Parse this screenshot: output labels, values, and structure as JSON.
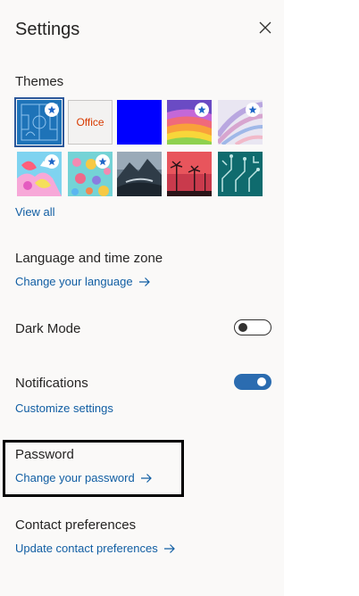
{
  "panel": {
    "title": "Settings",
    "close_icon": "close-icon"
  },
  "themes": {
    "heading": "Themes",
    "view_all": "View all",
    "tiles": [
      {
        "name": "theme-blueprint",
        "selected": true,
        "premium": true
      },
      {
        "name": "theme-office",
        "label": "Office",
        "selected": false,
        "premium": false
      },
      {
        "name": "theme-blue",
        "selected": false,
        "premium": false
      },
      {
        "name": "theme-rainbow",
        "selected": false,
        "premium": true
      },
      {
        "name": "theme-abstract",
        "selected": false,
        "premium": true
      },
      {
        "name": "theme-unicorn",
        "selected": false,
        "premium": true
      },
      {
        "name": "theme-cupcakes",
        "selected": false,
        "premium": true
      },
      {
        "name": "theme-mountain",
        "selected": false,
        "premium": false
      },
      {
        "name": "theme-palm-sunset",
        "selected": false,
        "premium": false
      },
      {
        "name": "theme-circuit",
        "selected": false,
        "premium": false
      }
    ]
  },
  "language": {
    "heading": "Language and time zone",
    "link": "Change your language"
  },
  "dark_mode": {
    "label": "Dark Mode",
    "enabled": false
  },
  "notifications": {
    "heading": "Notifications",
    "enabled": true,
    "link": "Customize settings"
  },
  "password": {
    "heading": "Password",
    "link": "Change your password"
  },
  "contact": {
    "heading": "Contact preferences",
    "link": "Update contact preferences"
  },
  "colors": {
    "panel_bg": "#faf9f8",
    "link": "#115ea3",
    "toggle_on": "#2b6cb0",
    "selected_outline": "#2b579a"
  }
}
